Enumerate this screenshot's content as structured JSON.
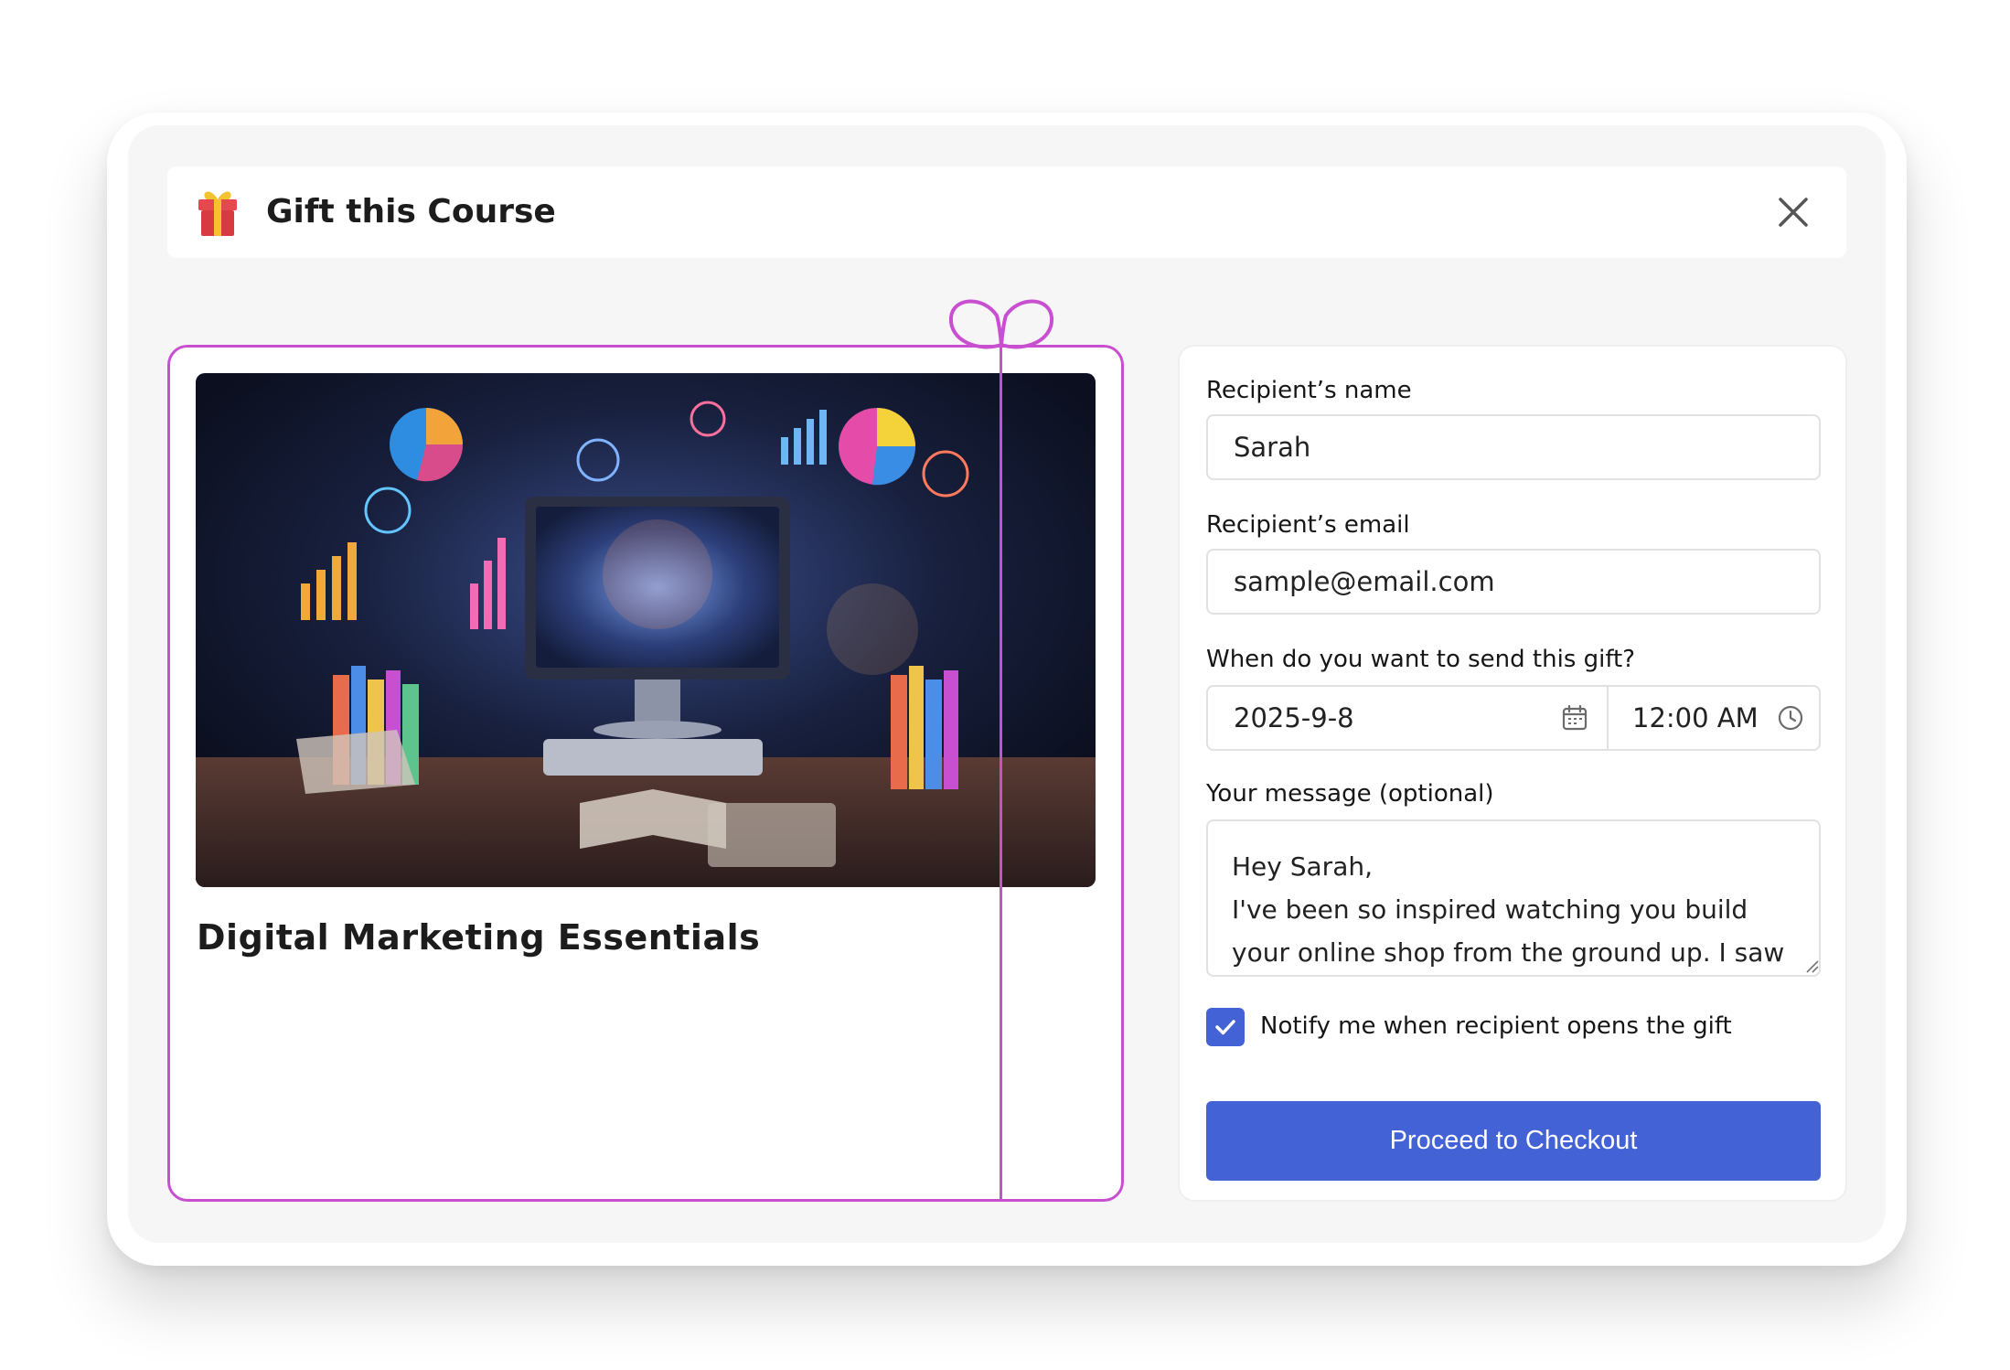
{
  "dialog": {
    "title": "Gift this Course",
    "icons": {
      "gift": "gift-icon",
      "close": "close-icon"
    }
  },
  "course": {
    "title": "Digital Marketing Essentials",
    "image_icon": "course-illustration"
  },
  "form": {
    "name_label": "Recipient’s name",
    "name_value": "Sarah",
    "email_label": "Recipient’s email",
    "email_value": "sample@email.com",
    "schedule_label": "When do you want to send this gift?",
    "date_value": "2025-9-8",
    "time_value": "12:00 AM",
    "message_label": "Your message (optional)",
    "message_value": "Hey Sarah,\nI've been so inspired watching you build your online shop from the ground up. I saw this",
    "notify_label": "Notify me when recipient opens the gift",
    "notify_checked": true,
    "checkout_label": "Proceed to Checkout"
  },
  "colors": {
    "accent": "#4362d5",
    "ribbon": "#c94fd1",
    "background": "#f6f6f6"
  }
}
